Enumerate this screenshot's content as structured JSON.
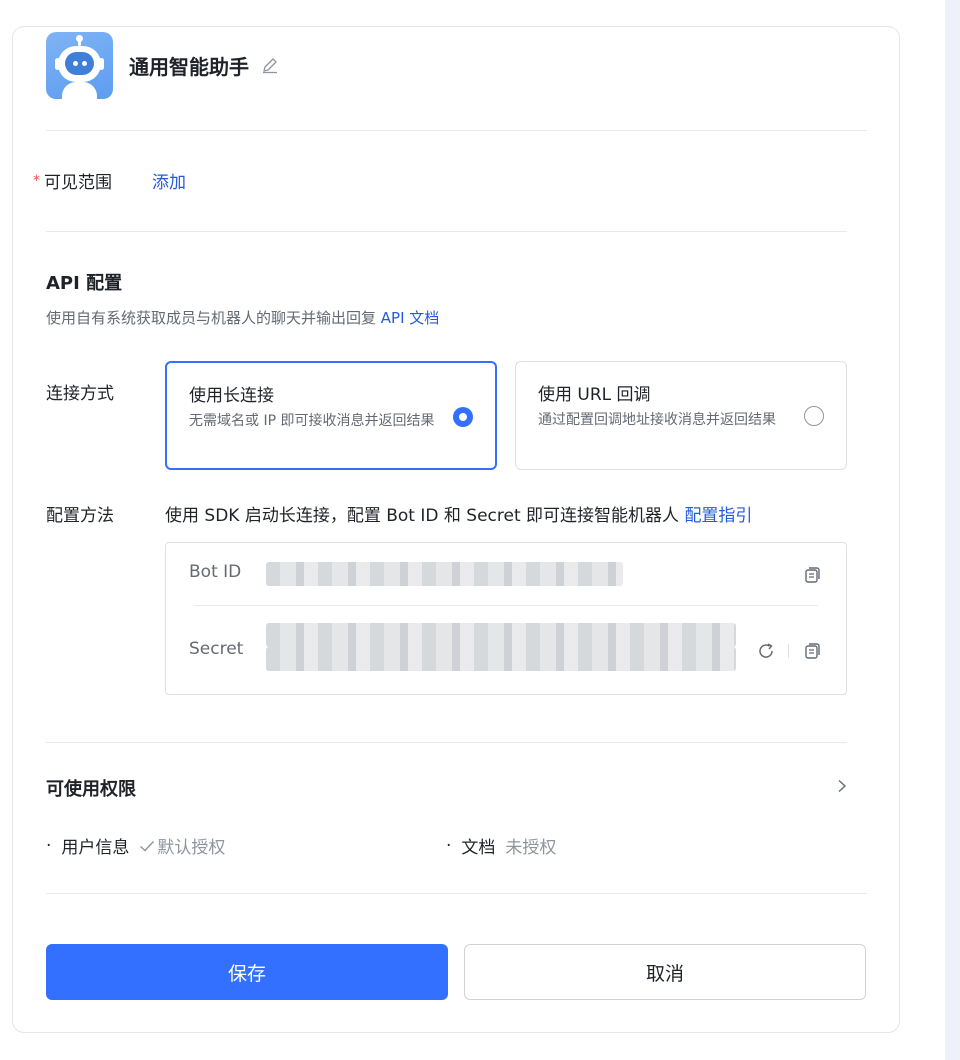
{
  "bot": {
    "name": "通用智能助手"
  },
  "visibility": {
    "required_mark": "*",
    "label": "可见范围",
    "add_link": "添加"
  },
  "api_config": {
    "title": "API 配置",
    "description": "使用自有系统获取成员与机器人的聊天并输出回复",
    "doc_link": "API 文档",
    "connection_label": "连接方式",
    "options": [
      {
        "title": "使用长连接",
        "description": "无需域名或 IP 即可接收消息并返回结果",
        "selected": true
      },
      {
        "title": "使用 URL 回调",
        "description": "通过配置回调地址接收消息并返回结果",
        "selected": false
      }
    ],
    "method_label": "配置方法",
    "method_text": "使用 SDK 启动长连接，配置 Bot ID 和 Secret 即可连接智能机器人",
    "method_link": "配置指引",
    "credentials": {
      "bot_id_label": "Bot ID",
      "secret_label": "Secret"
    }
  },
  "permissions": {
    "title": "可使用权限",
    "items": [
      {
        "bullet": "·",
        "name": "用户信息",
        "status": "默认授权",
        "granted": true
      },
      {
        "bullet": "·",
        "name": "文档",
        "status": "未授权",
        "granted": false
      }
    ]
  },
  "actions": {
    "save": "保存",
    "cancel": "取消"
  },
  "colors": {
    "primary": "#3370ff",
    "link": "#245bdb",
    "required": "#f54a45"
  }
}
